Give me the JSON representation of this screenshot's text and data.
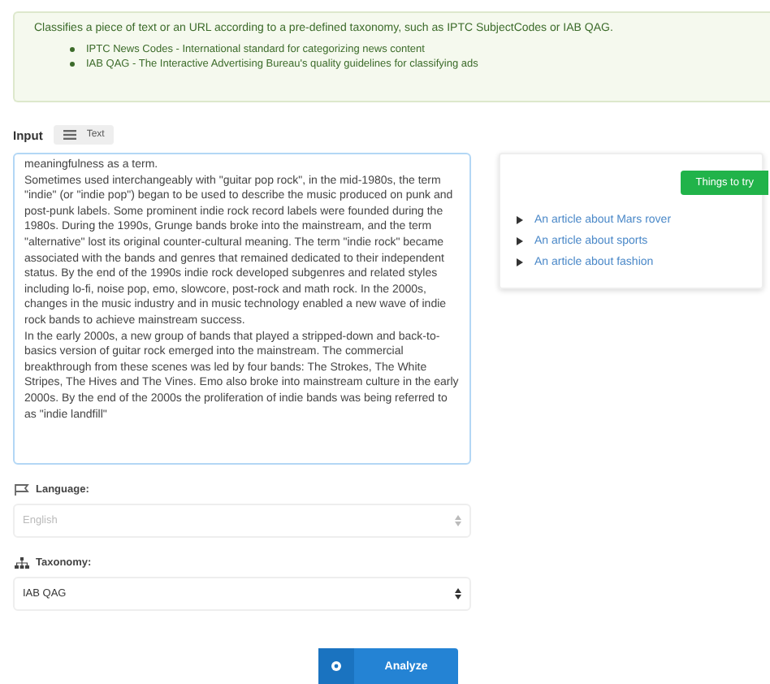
{
  "info": {
    "description": "Classifies a piece of text or an URL according to a pre-defined taxonomy, such as IPTC SubjectCodes or IAB QAG.",
    "items": [
      "IPTC News Codes - International standard for categorizing news content",
      "IAB QAG - The Interactive Advertising Bureau's quality guidelines for classifying ads"
    ]
  },
  "input": {
    "label": "Input",
    "mode_button": "Text",
    "value": "meaningfulness as a term.\nSometimes used interchangeably with \"guitar pop rock\", in the mid-1980s, the term \"indie\" (or \"indie pop\") began to be used to describe the music produced on punk and post-punk labels. Some prominent indie rock record labels were founded during the 1980s. During the 1990s, Grunge bands broke into the mainstream, and the term \"alternative\" lost its original counter-cultural meaning. The term \"indie rock\" became associated with the bands and genres that remained dedicated to their independent status. By the end of the 1990s indie rock developed subgenres and related styles including lo-fi, noise pop, emo, slowcore, post-rock and math rock. In the 2000s, changes in the music industry and in music technology enabled a new wave of indie rock bands to achieve mainstream success.\nIn the early 2000s, a new group of bands that played a stripped-down and back-to-basics version of guitar rock emerged into the mainstream. The commercial breakthrough from these scenes was led by four bands: The Strokes, The White Stripes, The Hives and The Vines. Emo also broke into mainstream culture in the early 2000s. By the end of the 2000s the proliferation of indie bands was being referred to as \"indie landfill\""
  },
  "things_to_try": {
    "title": "Things to try",
    "links": [
      "An article about Mars rover",
      "An article about sports",
      "An article about fashion"
    ]
  },
  "language": {
    "label": "Language:",
    "value": "English",
    "disabled": true
  },
  "taxonomy": {
    "label": "Taxonomy:",
    "value": "IAB QAG",
    "disabled": false
  },
  "analyze_button": "Analyze"
}
